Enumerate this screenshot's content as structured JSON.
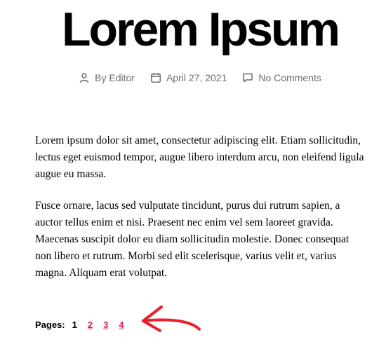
{
  "post": {
    "title": "Lorem Ipsum",
    "meta": {
      "author": "By Editor",
      "date": "April 27, 2021",
      "comments": "No Comments"
    },
    "paragraphs": [
      "Lorem ipsum dolor sit amet, consectetur adipiscing elit. Etiam sollicitudin, lectus eget euismod tempor, augue libero interdum arcu, non eleifend ligula augue eu massa.",
      "Fusce ornare, lacus sed vulputate tincidunt, purus dui rutrum sapien, a auctor tellus enim et nisi. Praesent nec enim vel sem laoreet gravida. Maecenas suscipit dolor eu diam sollicitudin molestie. Donec consequat non libero et rutrum. Morbi sed elit scelerisque, varius velit et, varius magna. Aliquam erat volutpat."
    ]
  },
  "pagination": {
    "label": "Pages:",
    "current": "1",
    "links": [
      "2",
      "3",
      "4"
    ]
  },
  "colors": {
    "link": "#cd2653",
    "meta_text": "#6d6d6d",
    "annotation_arrow": "#e8202a"
  },
  "icons": {
    "author": "person-icon",
    "date": "calendar-icon",
    "comments": "comment-bubble-icon",
    "annotation": "curved-arrow-icon"
  }
}
